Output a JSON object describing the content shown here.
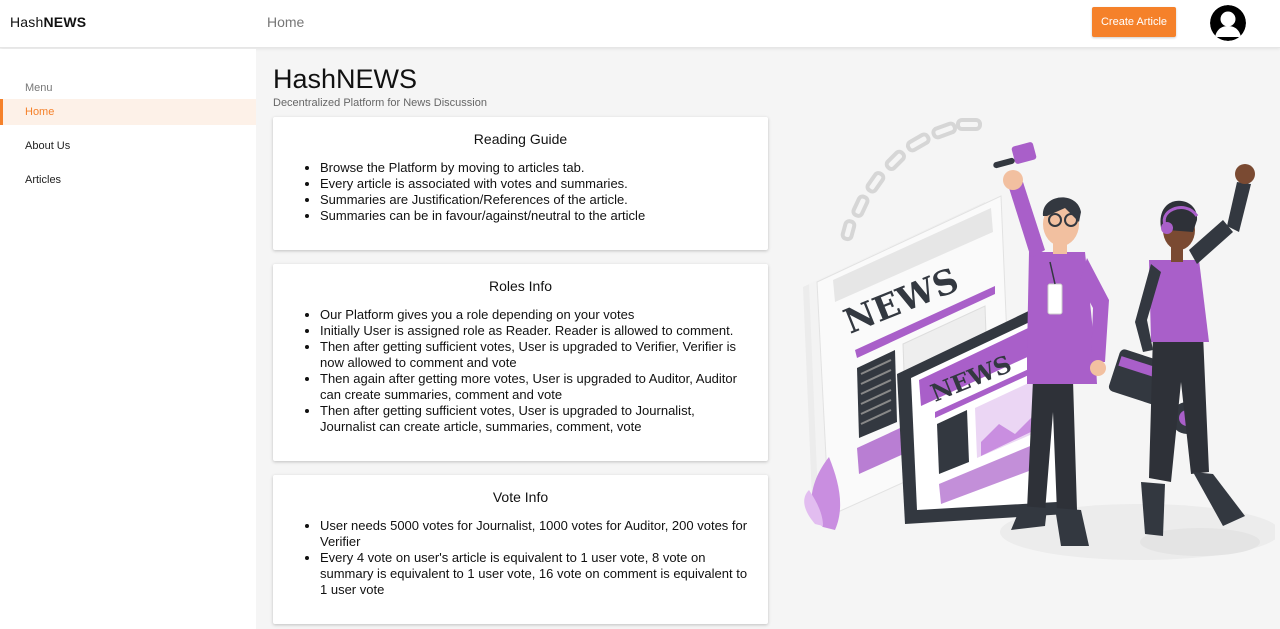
{
  "header": {
    "brand_prefix": "Hash",
    "brand_suffix": "NEWS",
    "nav_home": "Home",
    "create_button": "Create Article"
  },
  "sidebar": {
    "menu_title": "Menu",
    "items": [
      {
        "label": "Home",
        "active": true
      },
      {
        "label": "About Us",
        "active": false
      },
      {
        "label": "Articles",
        "active": false
      }
    ]
  },
  "main": {
    "title": "HashNEWS",
    "subtitle": "Decentralized Platform for News Discussion",
    "cards": [
      {
        "title": "Reading Guide",
        "items": [
          "Browse the Platform by moving to articles tab.",
          "Every article is associated with votes and summaries.",
          "Summaries are Justification/References of the article.",
          "Summaries can be in favour/against/neutral to the article"
        ]
      },
      {
        "title": "Roles Info",
        "items": [
          "Our Platform gives you a role depending on your votes",
          "Initially User is assigned role as Reader. Reader is allowed to comment.",
          "Then after getting sufficient votes, User is upgraded to Verifier, Verifier is now allowed to comment and vote",
          "Then again after getting more votes, User is upgraded to Auditor, Auditor can create summaries, comment and vote",
          "Then after getting sufficient votes, User is upgraded to Journalist, Journalist can create article, summaries, comment, vote"
        ]
      },
      {
        "title": "Vote Info",
        "items": [
          "User needs 5000 votes for Journalist, 1000 votes for Auditor, 200 votes for Verifier",
          "Every 4 vote on user's article is equivalent to 1 user vote, 8 vote on summary is equivalent to 1 user vote, 16 vote on comment is equivalent to 1 user vote"
        ]
      }
    ]
  },
  "illustration": {
    "newspaper_word": "NEWS",
    "tablet_word": "NEWS"
  },
  "colors": {
    "accent": "#f5812a",
    "purple": "#a95fc9",
    "dark": "#333840"
  }
}
